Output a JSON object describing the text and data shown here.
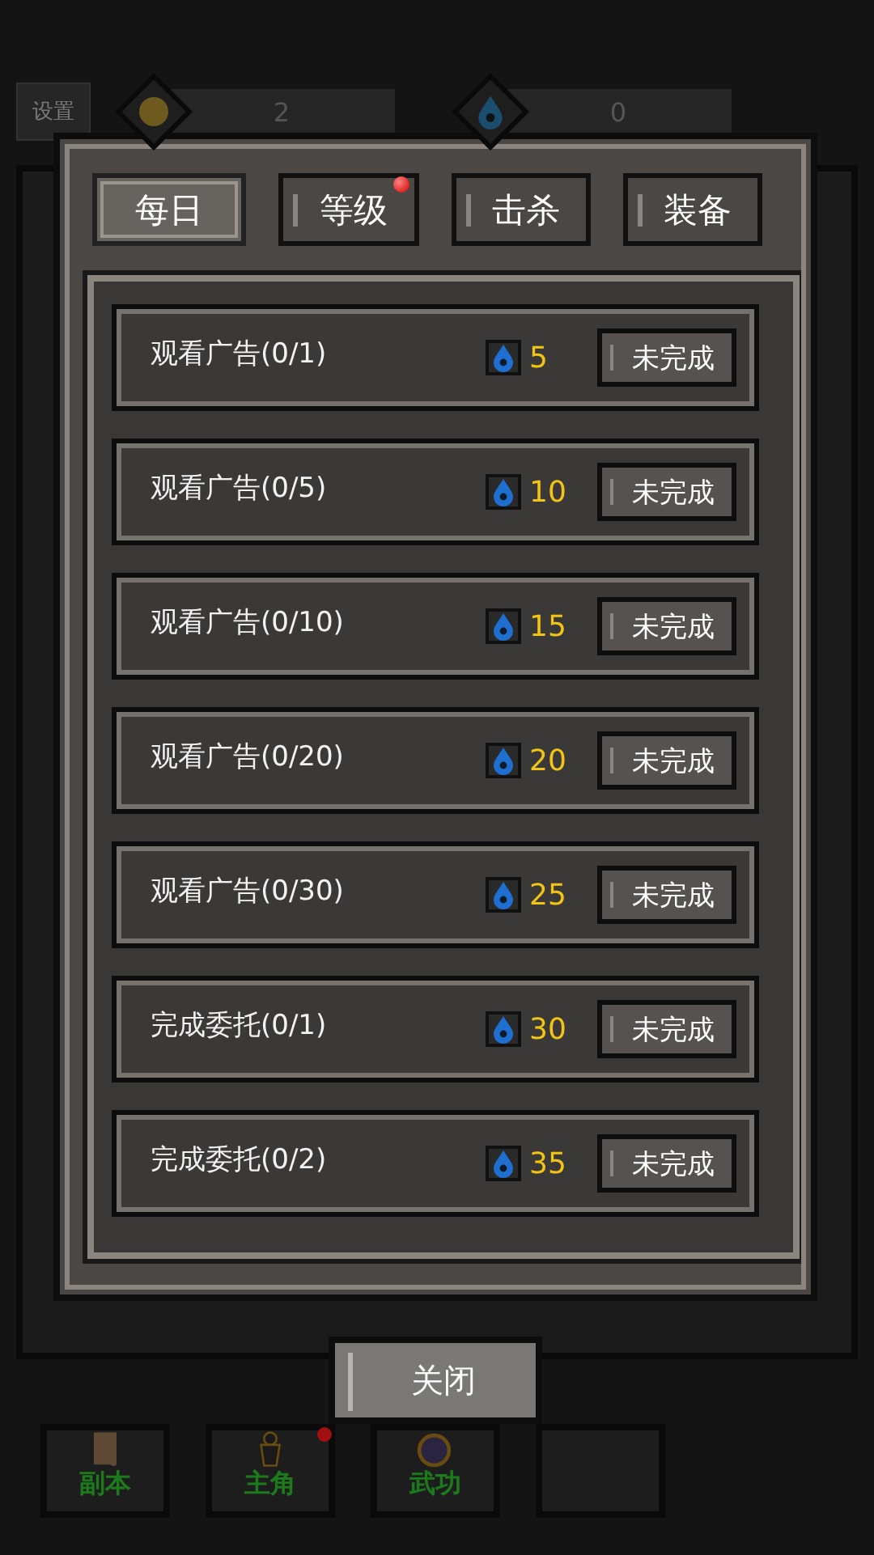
{
  "top_bar": {
    "settings": "设置",
    "coins": "2",
    "water": "0"
  },
  "dialog": {
    "tabs": [
      {
        "label": "每日",
        "selected": true,
        "badge": false
      },
      {
        "label": "等级",
        "selected": false,
        "badge": true
      },
      {
        "label": "击杀",
        "selected": false,
        "badge": false
      },
      {
        "label": "装备",
        "selected": false,
        "badge": false
      }
    ],
    "tasks": [
      {
        "title": "观看广告(0/1)",
        "reward": "5",
        "status": "未完成"
      },
      {
        "title": "观看广告(0/5)",
        "reward": "10",
        "status": "未完成"
      },
      {
        "title": "观看广告(0/10)",
        "reward": "15",
        "status": "未完成"
      },
      {
        "title": "观看广告(0/20)",
        "reward": "20",
        "status": "未完成"
      },
      {
        "title": "观看广告(0/30)",
        "reward": "25",
        "status": "未完成"
      },
      {
        "title": "完成委托(0/1)",
        "reward": "30",
        "status": "未完成"
      },
      {
        "title": "完成委托(0/2)",
        "reward": "35",
        "status": "未完成"
      }
    ],
    "close": "关闭"
  },
  "bottom_nav": [
    {
      "label": "副本",
      "kind": "scroll",
      "badge": false
    },
    {
      "label": "主角",
      "kind": "figure",
      "badge": true
    },
    {
      "label": "武功",
      "kind": "orb",
      "badge": false
    },
    {
      "kind": "empty",
      "badge": false
    }
  ]
}
